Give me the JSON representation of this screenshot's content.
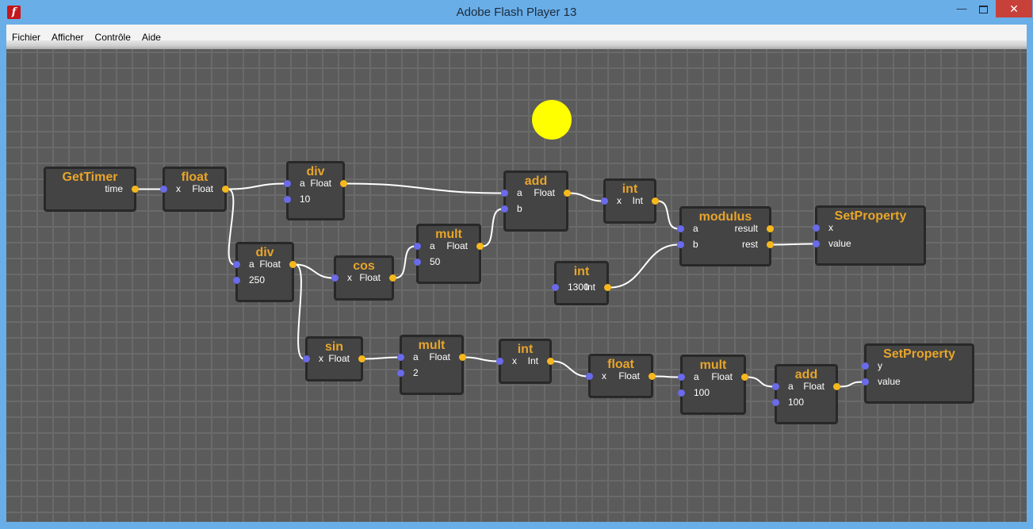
{
  "window": {
    "title": "Adobe Flash Player 13",
    "app_icon": "flash-icon",
    "minimize": "—",
    "close": "✕"
  },
  "menu": [
    {
      "pre": "",
      "u": "F",
      "post": "ichier"
    },
    {
      "pre": "Affic",
      "u": "h",
      "post": "er"
    },
    {
      "pre": "",
      "u": "C",
      "post": "ontrôle"
    },
    {
      "pre": "",
      "u": "A",
      "post": "ide"
    }
  ],
  "colors": {
    "wire": "#ffffff",
    "input_port": "#6a6aea",
    "output_port": "#f6b81d",
    "node_title": "#e8a52a",
    "ball": "#ffff00"
  },
  "nodes": {
    "gettimer": {
      "title": "GetTimer",
      "outputs": [
        "time"
      ]
    },
    "float1": {
      "title": "float",
      "inputs": [
        "x"
      ],
      "outputs": [
        "Float"
      ]
    },
    "div1": {
      "title": "div",
      "inputs": [
        "a",
        "10"
      ],
      "outputs": [
        "Float"
      ]
    },
    "div2": {
      "title": "div",
      "inputs": [
        "a",
        "250"
      ],
      "outputs": [
        "Float"
      ]
    },
    "cos": {
      "title": "cos",
      "inputs": [
        "x"
      ],
      "outputs": [
        "Float"
      ]
    },
    "mult1": {
      "title": "mult",
      "inputs": [
        "a",
        "50"
      ],
      "outputs": [
        "Float"
      ]
    },
    "add1": {
      "title": "add",
      "inputs": [
        "a",
        "b"
      ],
      "outputs": [
        "Float"
      ]
    },
    "int1": {
      "title": "int",
      "inputs": [
        "x"
      ],
      "outputs": [
        "Int"
      ]
    },
    "int1300": {
      "title": "int",
      "inputs": [
        "1300"
      ],
      "outputs": [
        "Int"
      ]
    },
    "modulus": {
      "title": "modulus",
      "inputs": [
        "a",
        "b"
      ],
      "outputs": [
        "result",
        "rest"
      ]
    },
    "setproperty1": {
      "title": "SetProperty",
      "inputs": [
        "x",
        "value"
      ]
    },
    "sin": {
      "title": "sin",
      "inputs": [
        "x"
      ],
      "outputs": [
        "Float"
      ]
    },
    "mult2": {
      "title": "mult",
      "inputs": [
        "a",
        "2"
      ],
      "outputs": [
        "Float"
      ]
    },
    "int2": {
      "title": "int",
      "inputs": [
        "x"
      ],
      "outputs": [
        "Int"
      ]
    },
    "float2": {
      "title": "float",
      "inputs": [
        "x"
      ],
      "outputs": [
        "Float"
      ]
    },
    "mult3": {
      "title": "mult",
      "inputs": [
        "a",
        "100"
      ],
      "outputs": [
        "Float"
      ]
    },
    "add2": {
      "title": "add",
      "inputs": [
        "a",
        "100"
      ],
      "outputs": [
        "Float"
      ]
    },
    "setproperty2": {
      "title": "SetProperty",
      "inputs": [
        "y",
        "value"
      ]
    }
  }
}
